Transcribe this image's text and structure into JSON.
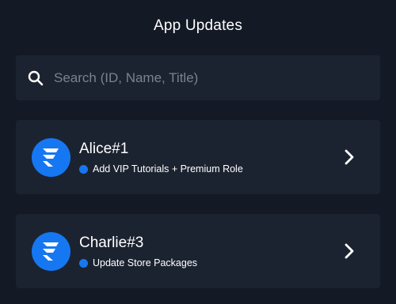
{
  "header": {
    "title": "App Updates"
  },
  "search": {
    "placeholder": "Search (ID, Name, Title)",
    "value": ""
  },
  "updates": [
    {
      "name": "Alice#1",
      "description": "Add VIP Tutorials + Premium Role"
    },
    {
      "name": "Charlie#3",
      "description": "Update Store Packages"
    }
  ],
  "colors": {
    "background": "#141a25",
    "card": "#1c2330",
    "accent": "#1677f2",
    "placeholder": "#7b828f"
  },
  "icons": {
    "search": "search-icon",
    "avatar": "app-logo-icon",
    "status": "status-dot-icon",
    "open": "chevron-right-icon"
  }
}
